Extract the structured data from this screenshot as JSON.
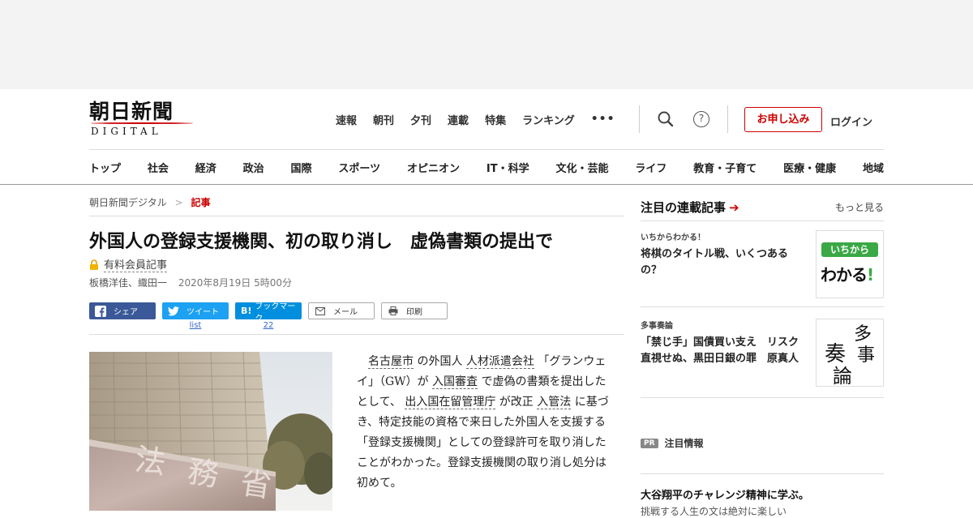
{
  "logo": {
    "kanji": "朝日新聞",
    "sub": "DIGITAL"
  },
  "top_nav": [
    "速報",
    "朝刊",
    "夕刊",
    "連載",
    "特集",
    "ランキング"
  ],
  "more_menu": "•••",
  "help_glyph": "?",
  "apply_button": "お申し込み",
  "login_link": "ログイン",
  "category_nav": [
    "トップ",
    "社会",
    "経済",
    "政治",
    "国際",
    "スポーツ",
    "オピニオン",
    "IT・科学",
    "文化・芸能",
    "ライフ",
    "教育・子育て",
    "医療・健康",
    "地域"
  ],
  "breadcrumb": {
    "home": "朝日新聞デジタル",
    "separator": ">",
    "current": "記事"
  },
  "article": {
    "headline": "外国人の登録支援機関、初の取り消し　虚偽書類の提出で",
    "paid_label": "有料会員記事",
    "authors": "板橋洋佳、織田一",
    "date": "2020年8月19日 5時00分",
    "body": {
      "indent": "　",
      "p1_link1": "名古屋市",
      "p1_t1": "の外国人",
      "p1_link2": "人材派遣会社",
      "p1_t2": "「グランウェイ」（GW）が",
      "p1_link3": "入国審査",
      "p1_t3": "で虚偽の書類を提出したとして、",
      "p1_link4": "出入国在留管理庁",
      "p1_t4": "が改正",
      "p1_link5": "入管法",
      "p1_t5": "に基づき、特定技能の資格で来日した外国人を支援する「登録支援機関」としての登録許可を取り消したことがわかった。登録支援機関の取り消し処分は初めて。"
    }
  },
  "share": {
    "facebook": "シェア",
    "twitter": "ツイート",
    "twitter_count": "list",
    "hatena": "ブックマーク",
    "hatena_icon": "B!",
    "hatena_count": "22",
    "mail": "メール",
    "print": "印刷"
  },
  "photo": {
    "signboard_text": "法務省"
  },
  "sidebar": {
    "heading": "注目の連載記事",
    "arrow": "➔",
    "more": "もっと見る",
    "serials": [
      {
        "kicker": "いちからわかる！",
        "title": "将棋のタイトル戦、いくつあるの？",
        "thumb_line1": "いちから",
        "thumb_line2": "わかる",
        "thumb_mark": "!"
      },
      {
        "kicker": "多事奏論",
        "title": "「禁じ手」国債買い支え　リスク直視せぬ、黒田日銀の罪　原真人",
        "thumb_chars": [
          "多",
          "事",
          "奏",
          "論"
        ]
      }
    ],
    "pr_badge": "PR",
    "pr_label": "注目情報",
    "promo_title": "大谷翔平のチャレンジ精神に学ぶ。",
    "promo_sub": "挑戦する人生の文は絶対に楽しい"
  },
  "colors": {
    "brand_red": "#cc0000",
    "facebook": "#3b5998",
    "twitter": "#1da1f2",
    "hatena": "#008fde"
  }
}
